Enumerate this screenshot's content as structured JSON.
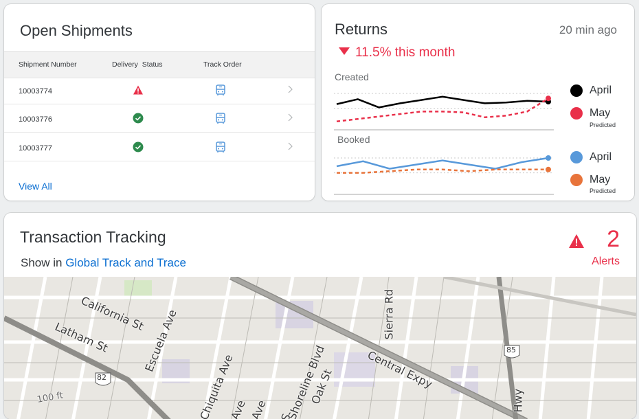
{
  "open_shipments": {
    "title": "Open Shipments",
    "columns": [
      "Shipment Number",
      "Delivery  Status",
      "Track Order"
    ],
    "rows": [
      {
        "number": "10003774",
        "status": "alert"
      },
      {
        "number": "10003776",
        "status": "ok"
      },
      {
        "number": "10003777",
        "status": "ok"
      }
    ],
    "view_all": "View All"
  },
  "returns": {
    "title": "Returns",
    "time": "20 min ago",
    "delta": "11.5% this month",
    "created_label": "Created",
    "booked_label": "Booked",
    "legend_created": [
      {
        "label": "April",
        "color": "#000000"
      },
      {
        "label": "May",
        "sub": "Predicted",
        "color": "#e9304a"
      }
    ],
    "legend_booked": [
      {
        "label": "April",
        "color": "#5899da"
      },
      {
        "label": "May",
        "sub": "Predicted",
        "color": "#e8743b"
      }
    ]
  },
  "chart_data": [
    {
      "type": "line",
      "title": "Created",
      "series": [
        {
          "name": "April",
          "color": "#000000",
          "dashed": false,
          "values": [
            54,
            66,
            46,
            56,
            64,
            72,
            64,
            56,
            58,
            62,
            60
          ]
        },
        {
          "name": "May",
          "color": "#e9304a",
          "dashed": true,
          "values": [
            12,
            18,
            24,
            30,
            36,
            36,
            34,
            22,
            26,
            36,
            68
          ]
        }
      ],
      "ylim": [
        0,
        100
      ]
    },
    {
      "type": "line",
      "title": "Booked",
      "series": [
        {
          "name": "April",
          "color": "#5899da",
          "dashed": false,
          "values": [
            60,
            72,
            54,
            64,
            74,
            64,
            54,
            70,
            80
          ]
        },
        {
          "name": "May",
          "color": "#e8743b",
          "dashed": true,
          "values": [
            44,
            44,
            48,
            52,
            52,
            48,
            52,
            52,
            52
          ]
        }
      ],
      "ylim": [
        0,
        100
      ]
    }
  ],
  "transaction_tracking": {
    "title": "Transaction Tracking",
    "show_in_prefix": "Show in ",
    "show_in_link": "Global Track and Trace",
    "alerts_count": "2",
    "alerts_label": "Alerts"
  },
  "map": {
    "streets": [
      "California St",
      "Latham St",
      "Escuela Ave",
      "Chiquita Ave",
      "Shoreline Blvd",
      "Oak St",
      "Sierra Rd",
      "Central Expy",
      "Ave",
      "Ave",
      "S",
      "100 ft",
      "Hwy"
    ],
    "route_shields": [
      "82",
      "85"
    ]
  }
}
